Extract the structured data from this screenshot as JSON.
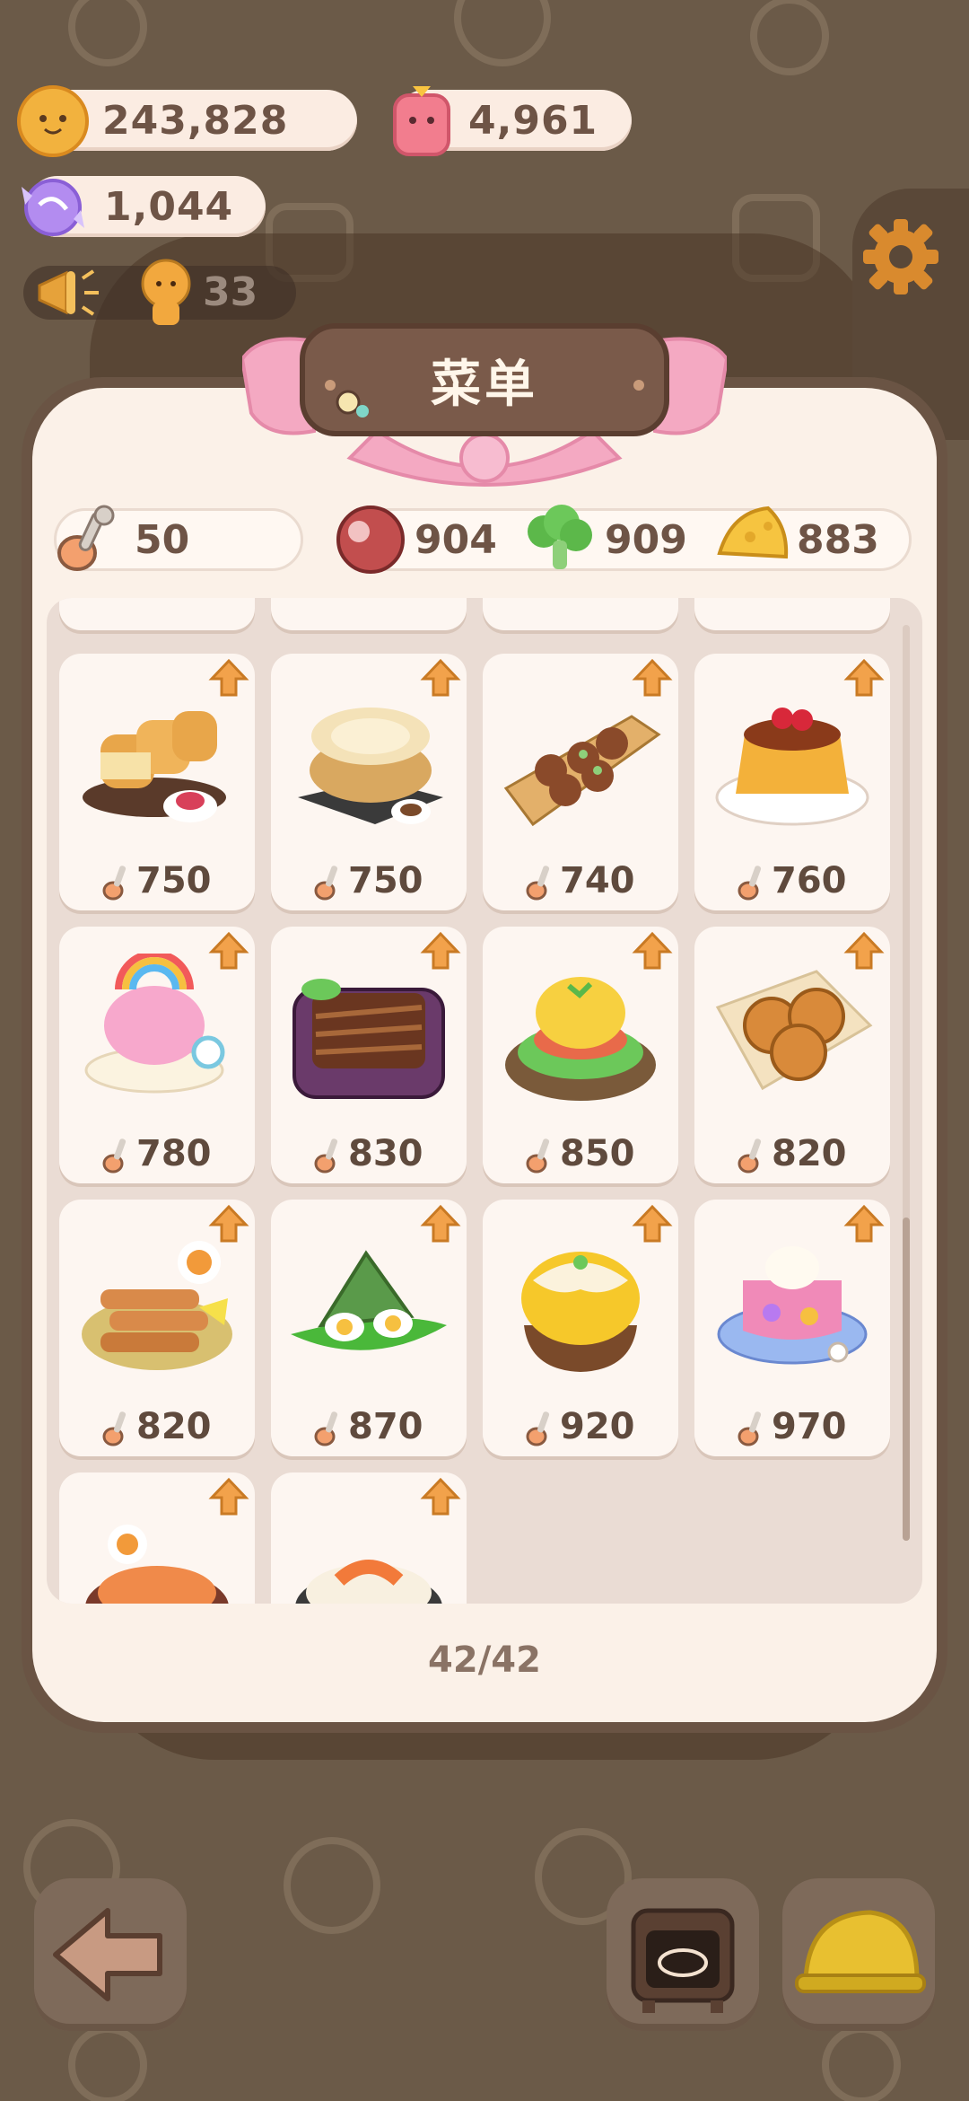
{
  "resources": {
    "cookies": "243,828",
    "gems": "4,961",
    "candy": "1,044",
    "notice_count": "33"
  },
  "menu": {
    "title": "菜单",
    "stats": {
      "spoon": "50",
      "meat": "904",
      "broccoli": "909",
      "cheese": "883"
    },
    "items": [
      {
        "name": "bread",
        "price": "750"
      },
      {
        "name": "xiaolongbao",
        "price": "750"
      },
      {
        "name": "takoyaki",
        "price": "740"
      },
      {
        "name": "pudding",
        "price": "760"
      },
      {
        "name": "rainbow-cupcake",
        "price": "780"
      },
      {
        "name": "braised-eel",
        "price": "830"
      },
      {
        "name": "eggs-benedict",
        "price": "850"
      },
      {
        "name": "apple-pie",
        "price": "820"
      },
      {
        "name": "skewers",
        "price": "820"
      },
      {
        "name": "zongzi",
        "price": "870"
      },
      {
        "name": "shaved-ice",
        "price": "920"
      },
      {
        "name": "jelly-cake",
        "price": "970"
      }
    ],
    "counter": "42/42"
  },
  "colors": {
    "background": "#6b5a48",
    "card": "#fbf1e8",
    "ribbon": "#f4a9c2",
    "text": "#6e5446",
    "arrow": "#f2a24b"
  }
}
